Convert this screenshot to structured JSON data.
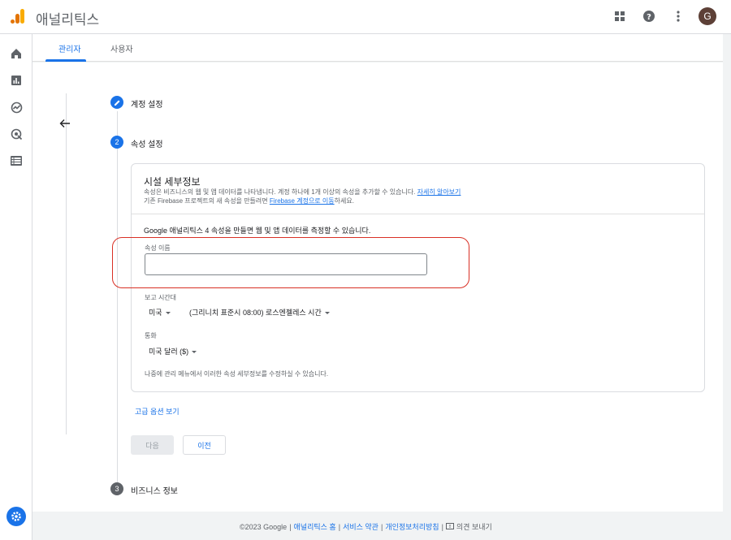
{
  "app": {
    "title": "애널리틱스"
  },
  "user": {
    "avatar_initial": "G"
  },
  "tabs": [
    {
      "label": "관리자"
    },
    {
      "label": "사용자"
    }
  ],
  "steps": [
    {
      "number": "",
      "label": "계정 설정"
    },
    {
      "number": "2",
      "label": "속성 설정"
    },
    {
      "number": "3",
      "label": "비즈니스 정보"
    }
  ],
  "card": {
    "title": "시설 세부정보",
    "desc1": "속성은 비즈니스의 웹 및 앱 데이터를 나타냅니다. 계정 하나에 1개 이상의 속성을 추가할 수 있습니다.",
    "desc1_link": "자세히 알아보기",
    "desc2_pre": "기존 Firebase 프로젝트의 새 속성을 만들려면 ",
    "desc2_link": "Firebase 계정으로 이동",
    "desc2_post": "하세요.",
    "intro": "Google 애널리틱스 4 속성을 만들면 웹 및 앱 데이터를 측정할 수 있습니다.",
    "property_name_label": "속성 이름",
    "property_name_value": "",
    "timezone_label": "보고 시간대",
    "country": "미국",
    "timezone": "(그리니치 표준시 08:00) 로스엔젤레스 시간",
    "currency_label": "통화",
    "currency": "미국 달러 ($)",
    "note": "나중에 관리 메뉴에서 이러한 속성 세부정보를 수정하실 수 있습니다."
  },
  "actions": {
    "advanced": "고급 옵션 보기",
    "next": "다음",
    "prev": "이전"
  },
  "footer": {
    "copyright": "©2023 Google",
    "home": "애널리틱스 홈",
    "terms": "서비스 약관",
    "privacy": "개인정보처리방침",
    "feedback": "의견 보내기"
  },
  "colors": {
    "accent": "#1a73e8",
    "highlight": "#d93025",
    "logo_orange": "#f9ab00",
    "logo_dark": "#e37400"
  }
}
